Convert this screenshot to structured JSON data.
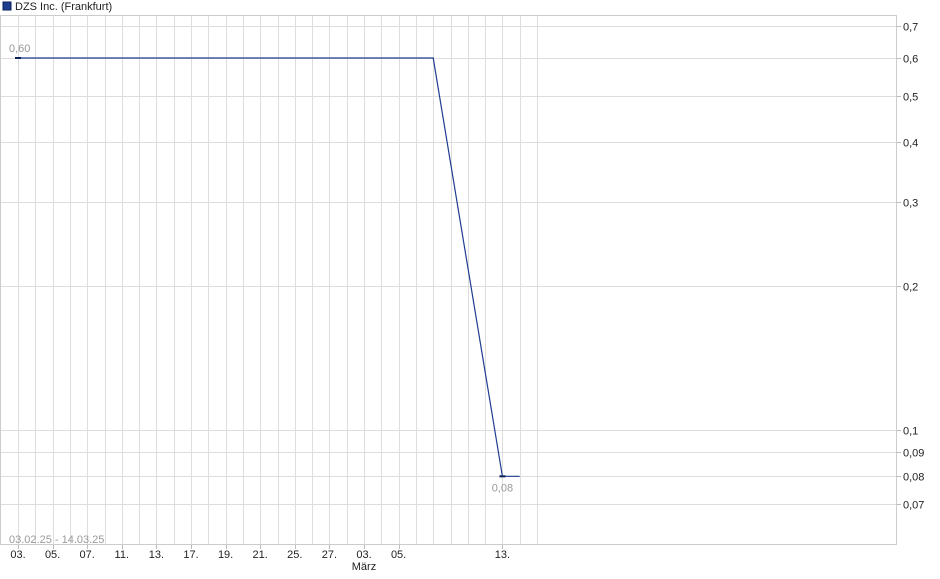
{
  "chart_data": {
    "type": "line",
    "title": "",
    "xlabel": "",
    "ylabel": "",
    "y_scale": "log",
    "ylim": [
      0.06,
      0.75
    ],
    "grid": true,
    "legend": {
      "position": "top-left",
      "entries": [
        "DZS Inc. (Frankfurt)"
      ]
    },
    "date_range_text": "03.02.25 - 14.03.25",
    "x_ticks": [
      "03.",
      "05.",
      "07.",
      "11.",
      "13.",
      "17.",
      "19.",
      "21.",
      "25.",
      "27.",
      "03.",
      "05.",
      "13."
    ],
    "x_tick_dates": [
      "2025-02-03",
      "2025-02-05",
      "2025-02-07",
      "2025-02-11",
      "2025-02-13",
      "2025-02-17",
      "2025-02-19",
      "2025-02-21",
      "2025-02-25",
      "2025-02-27",
      "2025-03-03",
      "2025-03-05",
      "2025-03-13"
    ],
    "month_labels": [
      {
        "label": "März",
        "date": "2025-03-03"
      }
    ],
    "y_ticks": [
      "0,7",
      "0,6",
      "0,5",
      "0,4",
      "0,3",
      "0,2",
      "0,1",
      "0,09",
      "0,08",
      "0,07"
    ],
    "y_tick_values": [
      0.7,
      0.6,
      0.5,
      0.4,
      0.3,
      0.2,
      0.1,
      0.09,
      0.08,
      0.07
    ],
    "series": [
      {
        "name": "DZS Inc. (Frankfurt)",
        "color": "#1f3d8f",
        "points": [
          {
            "x": "2025-02-03",
            "y": 0.6
          },
          {
            "x": "2025-03-07",
            "y": 0.6
          },
          {
            "x": "2025-03-13",
            "y": 0.08
          },
          {
            "x": "2025-03-14",
            "y": 0.08
          }
        ]
      }
    ],
    "annotations": [
      {
        "text": "0,60",
        "x": "2025-02-03",
        "y": 0.6
      },
      {
        "text": "0,08",
        "x": "2025-03-13",
        "y": 0.08
      }
    ]
  }
}
